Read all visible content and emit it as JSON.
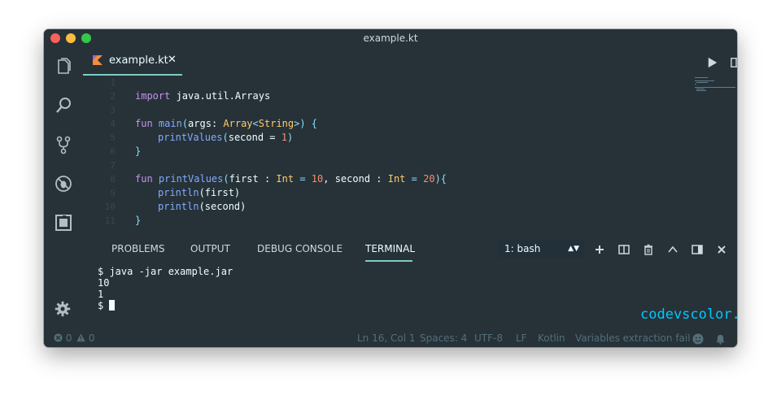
{
  "window": {
    "title": "example.kt"
  },
  "tab": {
    "label": "example.kt",
    "close": "✕"
  },
  "editor": {
    "lines": [
      {
        "n": "1"
      },
      {
        "n": "2"
      },
      {
        "n": "3"
      },
      {
        "n": "4"
      },
      {
        "n": "5"
      },
      {
        "n": "6"
      },
      {
        "n": "7"
      },
      {
        "n": "8"
      },
      {
        "n": "9"
      },
      {
        "n": "10"
      },
      {
        "n": "11"
      }
    ],
    "tokens": {
      "import_kw": "import",
      "import_path": " java.util.Arrays",
      "fun_kw": "fun",
      "main_name": " main",
      "main_open": "(",
      "args_param": "args: ",
      "array_type": "Array",
      "lt": "<",
      "string_type": "String",
      "gt": ">",
      "main_close": ") {",
      "call_name": "printValues",
      "call_open": "(",
      "call_arg": "second = ",
      "call_num": "1",
      "call_close": ")",
      "brace_close": "}",
      "fun2_kw": "fun",
      "pv_name": " printValues",
      "pv_open": "(",
      "pv_first": "first : ",
      "int_type": "Int",
      "eq": " = ",
      "num10": "10",
      "pv_second": ", second : ",
      "int_type2": "Int",
      "eq2": " = ",
      "num20": "20",
      "pv_close": "){",
      "println1": "println",
      "pl1_arg": "(first)",
      "println2": "println",
      "pl2_arg": "(second)",
      "brace_close2": "}"
    }
  },
  "panel": {
    "tabs": [
      "PROBLEMS",
      "OUTPUT",
      "DEBUG CONSOLE",
      "TERMINAL"
    ],
    "terminal_select": "1: bash",
    "terminal_lines": [
      "$ java -jar example.jar",
      "10",
      "1",
      "$ "
    ]
  },
  "watermark": "codevscolor.com",
  "statusbar": {
    "errors": "0",
    "warnings": "0",
    "position": "Ln 16, Col 1",
    "spaces": "Spaces: 4",
    "encoding": "UTF-8",
    "eol": "LF",
    "language": "Kotlin",
    "message": "Variables extraction fail"
  },
  "colors": {
    "background": "#263238",
    "accent": "#80cbc4",
    "keyword": "#f07178",
    "type": "#ffcb6b",
    "number": "#f78c6c",
    "function": "#82aaff"
  }
}
